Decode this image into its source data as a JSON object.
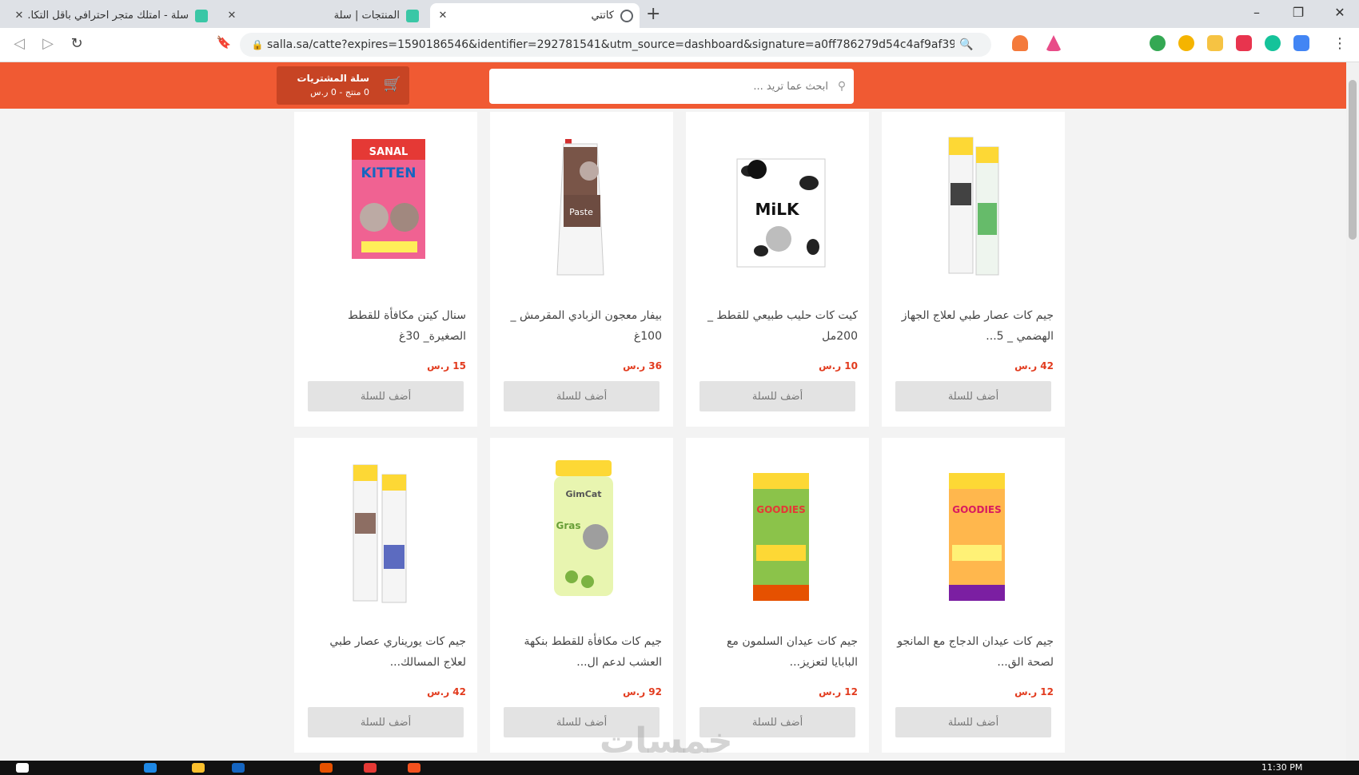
{
  "browser": {
    "tabs": [
      {
        "title": "سلة - امتلك متجر احترافي بأقل التكا...",
        "active": false,
        "favicon_color": "#3ac7a6"
      },
      {
        "title": "المنتجات | سلة",
        "active": false,
        "favicon_color": "#3ac7a6"
      },
      {
        "title": "كاتتي",
        "active": true,
        "favicon_color": "#5f6368"
      }
    ],
    "new_tab_label": "+",
    "url": "salla.sa/catte?expires=1590186546&identifier=292781541&utm_source=dashboard&signature=a0ff786279d54c4af9af39f6f69..."
  },
  "store": {
    "search_placeholder": "ابحث عما تريد ...",
    "cart_title": "سلة المشتريات",
    "cart_summary": "0 منتج - 0 ر.س",
    "accent_color": "#f05a33"
  },
  "products": [
    {
      "name": "سنال كيتن مكافأة للقطط الصغيرة_ 30غ",
      "price": "15 ر.س",
      "button": "أضف للسلة",
      "image": "kitten-treat-box"
    },
    {
      "name": "بيفار معجون الزبادي المقرمش _ 100غ",
      "price": "36 ر.س",
      "button": "أضف للسلة",
      "image": "yoghurt-paste-tube"
    },
    {
      "name": "كيت كات حليب طبيعي للقطط _ 200مل",
      "price": "10 ر.س",
      "button": "أضف للسلة",
      "image": "milk-carton"
    },
    {
      "name": "جيم كات عصار طبي لعلاج الجهاز الهضمي _ 5...",
      "price": "42 ر.س",
      "button": "أضف للسلة",
      "image": "malt-paste-tube"
    },
    {
      "name": "جيم كات يوريناري عصار طبي لعلاج المسالك...",
      "price": "42 ر.س",
      "button": "أضف للسلة",
      "image": "urinary-paste-tube"
    },
    {
      "name": "جيم كات مكافأة للقطط بنكهة العشب لدعم ال...",
      "price": "92 ر.س",
      "button": "أضف للسلة",
      "image": "grass-bits-jar"
    },
    {
      "name": "جيم كات عيدان السلمون مع البابايا لتعزيز...",
      "price": "12 ر.س",
      "button": "أضف للسلة",
      "image": "salmon-sticks"
    },
    {
      "name": "جيم كات عيدان الدجاج مع المانجو لصحة الق...",
      "price": "12 ر.س",
      "button": "أضف للسلة",
      "image": "chicken-sticks"
    }
  ],
  "taskbar": {
    "clock": "11:30 PM"
  },
  "watermark": "خمسات"
}
